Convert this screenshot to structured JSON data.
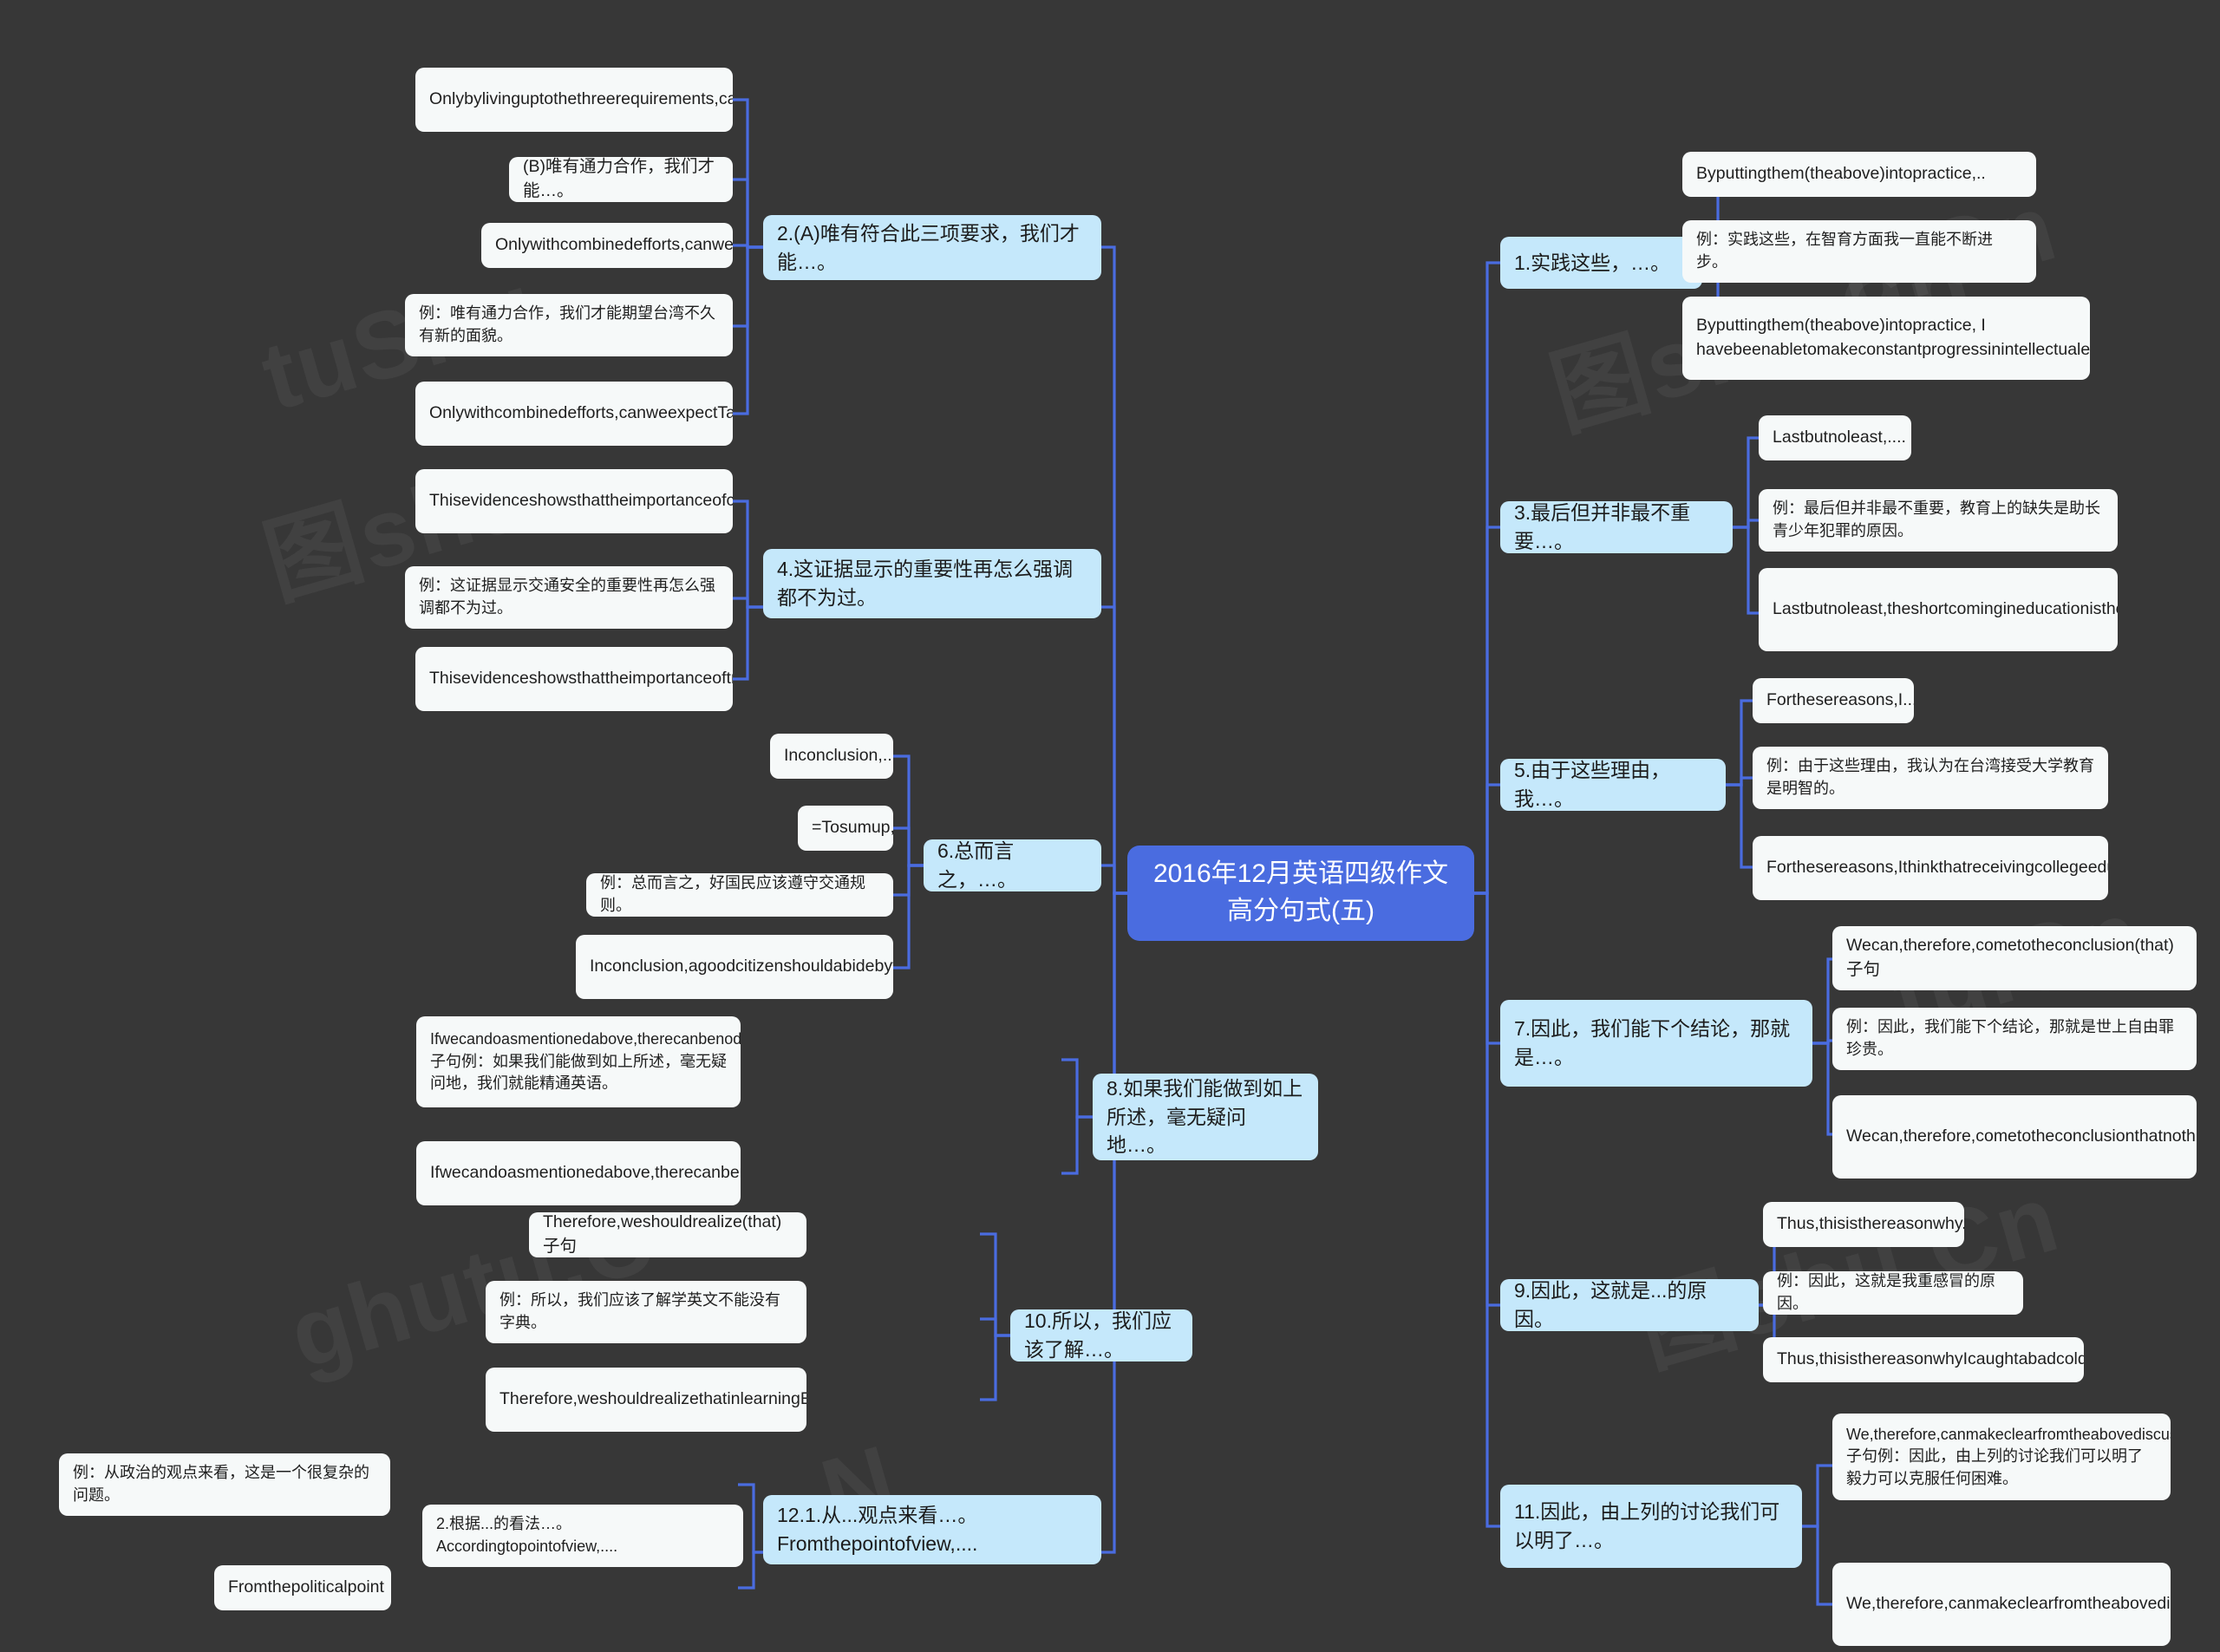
{
  "title": "2016年12月英语四级作文高分句式(五)",
  "colors": {
    "background": "#373737",
    "root_fill": "#4a6ce0",
    "root_text": "#ffffff",
    "level1_fill": "#c5e8fb",
    "leaf_fill": "#f6f9f9",
    "link": "#4a6ce0"
  },
  "watermarks": [
    "tuShu",
    "tushu",
    "图shu",
    "tu.Cn",
    "shu.Cn",
    "图shu.Cn"
  ],
  "left_branches": [
    {
      "label": "2.(A)唯有符合此三项要求，我们才能…。",
      "children": [
        "Onlybylivinguptothethreerequirements,canwe....",
        "(B)唯有通力合作，我们才能…。",
        "Onlywithcombinedefforts,canwe..",
        "例：唯有通力合作，我们才能期望台湾不久有新的面貌。",
        "Onlywithcombinedefforts,canweexpectTaiwantotakeanewfaceinduecourse."
      ]
    },
    {
      "label": "4.这证据显示的重要性再怎么强调都不为过。",
      "children": [
        "Thisevidenceshowsthattheimportanceofcannotbeoveremphasized.",
        "例：这证据显示交通安全的重要性再怎么强调都不为过。",
        "Thisevidenceshowsthattheimportanceoftrafficsafetycannotbeoveremphasized."
      ]
    },
    {
      "label": "6.总而言之，…。",
      "children": [
        "Inconclusion,....",
        "=Tosumup,.",
        "例：总而言之，好国民应该遵守交通规则。",
        "Inconclusion,agoodcitizenshouldabidebytrafficregulations."
      ]
    },
    {
      "label": "8.如果我们能做到如上所述，毫无疑问地…。",
      "children": [
        "Ifwecandoasmentionedabove,therecanbenodoubt(that)子句例：如果我们能做到如上所述，毫无疑问地，我们就能精通英语。",
        "Ifwecandoasmentionedabove,therecanbenodoubtthatwecanmasterEnglish"
      ]
    },
    {
      "label": "10.所以，我们应该了解…。",
      "children": [
        "Therefore,weshouldrealize(that)子句",
        "例：所以，我们应该了解学英文不能没有字典。",
        "Therefore,weshouldrealizethatinlearningEnglishwecannotdowithoutadictionary."
      ]
    },
    {
      "label": "12.1.从...观点来看…。Fromthepointofview,....",
      "children": [
        "2.根据...的看法…。Accordingtopointofview,....",
        "例：从政治的观点来看，这是一个很复杂的问题。",
        "Fromthepoliticalpoint"
      ]
    }
  ],
  "right_branches": [
    {
      "label": "1.实践这些，…。",
      "children": [
        "Byputtingthem(theabove)intopractice,..",
        "例：实践这些，在智育方面我一直能不断进步。",
        "Byputtingthem(theabove)intopractice, I havebeenabletomakeconstantprogressinintellectualeducation."
      ]
    },
    {
      "label": "3.最后但并非最不重要…。",
      "children": [
        "Lastbutnoleast,....",
        "例：最后但并非最不重要，教育上的缺失是助长青少年犯罪的原因。",
        "Lastbutnoleast,theshortcomingineducationisthecausecontributingtojuveniledelinquency."
      ]
    },
    {
      "label": "5.由于这些理由，我…。",
      "children": [
        "Forthesereasons,I....",
        "例：由于这些理由，我认为在台湾接受大学教育是明智的。",
        "Forthesereasons,IthinkthatreceivingcollegeeducationinTaiwaniswise."
      ]
    },
    {
      "label": "7.因此，我们能下个结论，那就是…。",
      "children": [
        "Wecan,therefore,cometotheconclusion(that)子句",
        "例：因此，我们能下个结论，那就是世上自由罪珍贵。",
        "Wecan,therefore,cometotheconclusionthatnothingissopreciousasfreedomintheworld."
      ]
    },
    {
      "label": "9.因此，这就是...的原因。",
      "children": [
        "Thus,thisisthereasonwhy..",
        "例：因此，这就是我重感冒的原因。",
        "Thus,thisisthereasonwhyIcaughtabadcold."
      ]
    },
    {
      "label": "11.因此，由上列的讨论我们可以明了…。",
      "children": [
        "We,therefore,canmakeclearfromtheabovediscussion(that)子句例：因此，由上列的讨论我们可以明了毅力可以克服任何困难。",
        "We,therefore,canmakeclearfromtheabovediscussionthatperseverancecanovercomeanydifficulty."
      ]
    }
  ]
}
